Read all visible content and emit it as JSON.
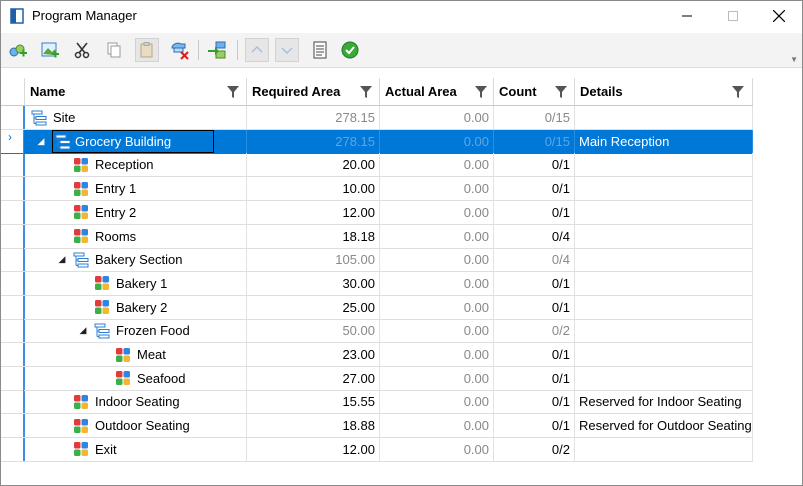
{
  "window": {
    "title": "Program Manager"
  },
  "toolbar": {
    "buttons": [
      {
        "name": "add-site-button",
        "icon": "add-site-icon"
      },
      {
        "name": "add-building-button",
        "icon": "add-image-icon"
      },
      {
        "name": "cut-button",
        "icon": "scissors-icon"
      },
      {
        "name": "copy-button",
        "icon": "copy-icon"
      },
      {
        "name": "paste-button",
        "icon": "paste-icon"
      },
      {
        "name": "delete-button",
        "icon": "delete-icon"
      },
      {
        "name": "import-button",
        "icon": "import-icon"
      },
      {
        "name": "move-up-button",
        "icon": "chevron-up-icon"
      },
      {
        "name": "move-down-button",
        "icon": "chevron-down-icon"
      },
      {
        "name": "report-button",
        "icon": "document-icon"
      },
      {
        "name": "validate-button",
        "icon": "check-circle-icon"
      }
    ]
  },
  "columns": {
    "name": "Name",
    "required_area": "Required Area",
    "actual_area": "Actual Area",
    "count": "Count",
    "details": "Details"
  },
  "rows": [
    {
      "name": "Site",
      "required": "278.15",
      "actual": "0.00",
      "count": "0/15",
      "details": "",
      "level": 0,
      "type": "group",
      "expanded": true,
      "grey": true
    },
    {
      "name": "Grocery Building",
      "required": "278.15",
      "actual": "0.00",
      "count": "0/15",
      "details": "Main Reception",
      "level": 1,
      "type": "group",
      "expanded": true,
      "grey": true,
      "selected": true
    },
    {
      "name": "Reception",
      "required": "20.00",
      "actual": "0.00",
      "count": "0/1",
      "details": "",
      "level": 2,
      "type": "space"
    },
    {
      "name": "Entry 1",
      "required": "10.00",
      "actual": "0.00",
      "count": "0/1",
      "details": "",
      "level": 2,
      "type": "space"
    },
    {
      "name": "Entry 2",
      "required": "12.00",
      "actual": "0.00",
      "count": "0/1",
      "details": "",
      "level": 2,
      "type": "space"
    },
    {
      "name": "Rooms",
      "required": "18.18",
      "actual": "0.00",
      "count": "0/4",
      "details": "",
      "level": 2,
      "type": "space"
    },
    {
      "name": "Bakery Section",
      "required": "105.00",
      "actual": "0.00",
      "count": "0/4",
      "details": "",
      "level": 2,
      "type": "group",
      "expanded": true,
      "grey": true
    },
    {
      "name": "Bakery 1",
      "required": "30.00",
      "actual": "0.00",
      "count": "0/1",
      "details": "",
      "level": 3,
      "type": "space"
    },
    {
      "name": "Bakery 2",
      "required": "25.00",
      "actual": "0.00",
      "count": "0/1",
      "details": "",
      "level": 3,
      "type": "space"
    },
    {
      "name": "Frozen Food",
      "required": "50.00",
      "actual": "0.00",
      "count": "0/2",
      "details": "",
      "level": 3,
      "type": "group",
      "expanded": true,
      "grey": true
    },
    {
      "name": "Meat",
      "required": "23.00",
      "actual": "0.00",
      "count": "0/1",
      "details": "",
      "level": 4,
      "type": "space"
    },
    {
      "name": "Seafood",
      "required": "27.00",
      "actual": "0.00",
      "count": "0/1",
      "details": "",
      "level": 4,
      "type": "space"
    },
    {
      "name": "Indoor Seating",
      "required": "15.55",
      "actual": "0.00",
      "count": "0/1",
      "details": "Reserved for Indoor Seating",
      "level": 2,
      "type": "space"
    },
    {
      "name": "Outdoor Seating",
      "required": "18.88",
      "actual": "0.00",
      "count": "0/1",
      "details": "Reserved for Outdoor Seating",
      "level": 2,
      "type": "space"
    },
    {
      "name": "Exit",
      "required": "12.00",
      "actual": "0.00",
      "count": "0/2",
      "details": "",
      "level": 2,
      "type": "space"
    }
  ],
  "colors": {
    "selection": "#0078d7",
    "accent": "#3a8ee6"
  }
}
